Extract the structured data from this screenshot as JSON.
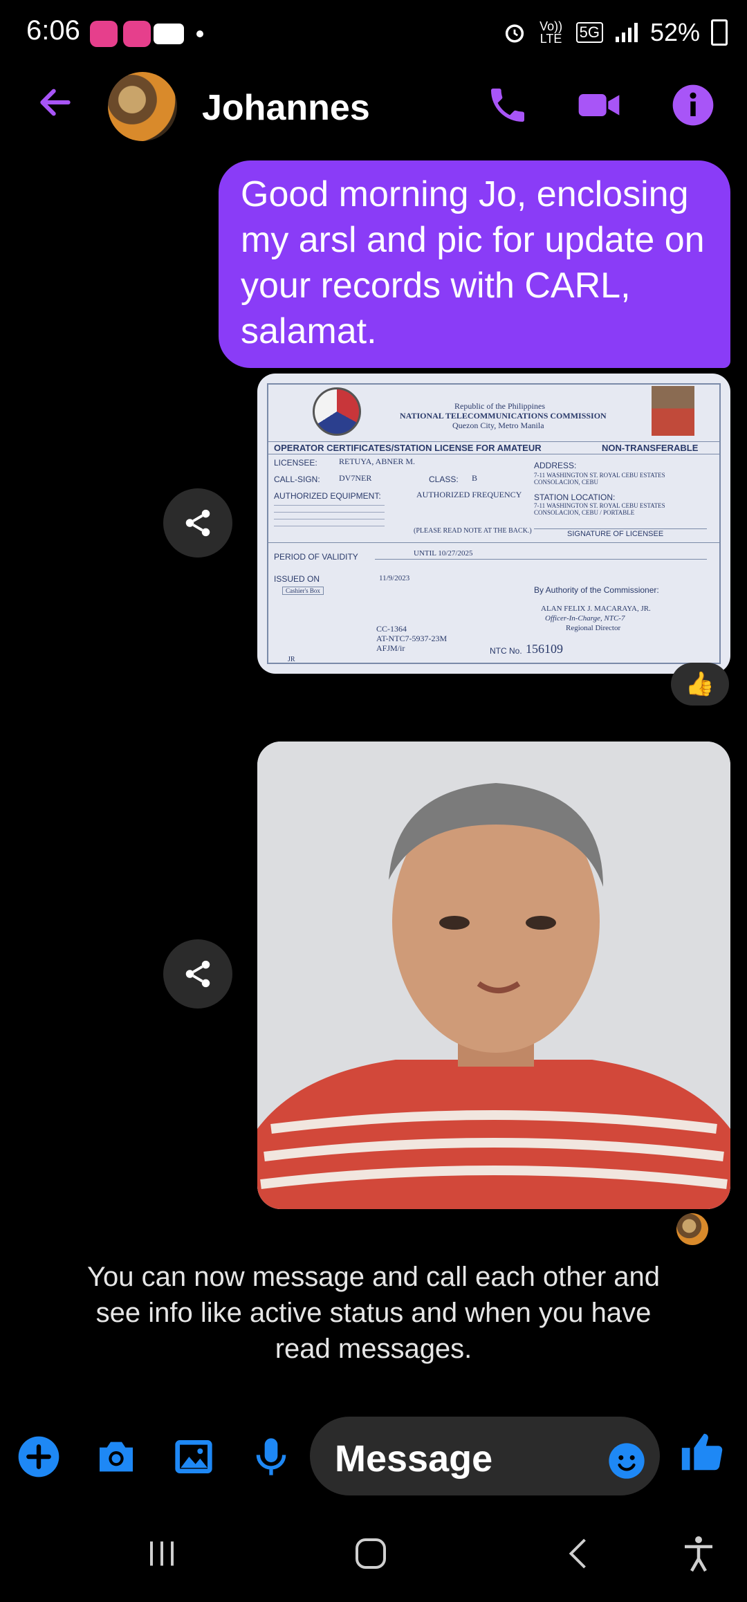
{
  "status_bar": {
    "time": "6:06",
    "app_badge_1": "Laz",
    "app_badge_2": "Laz",
    "network_label": "Vo)) LTE",
    "network_type": "5G",
    "battery": "52%"
  },
  "header": {
    "contact_name": "Johannes"
  },
  "messages": {
    "outgoing_text": "Good morning Jo, enclosing my arsl and pic for update on your records with CARL, salamat.",
    "reaction": "👍",
    "system_notice": "You can now message and call each other and see info like active status and when you have read messages."
  },
  "license_document": {
    "republic": "Republic of the Philippines",
    "agency": "NATIONAL TELECOMMUNICATIONS COMMISSION",
    "city": "Quezon City, Metro Manila",
    "doc_title": "OPERATOR CERTIFICATES/STATION LICENSE FOR AMATEUR",
    "non_transferable": "NON-TRANSFERABLE",
    "licensee_label": "LICENSEE:",
    "licensee": "RETUYA, ABNER M.",
    "callsign_label": "CALL-SIGN:",
    "callsign": "DV7NER",
    "class_label": "CLASS:",
    "class": "B",
    "equipment_label": "AUTHORIZED EQUIPMENT:",
    "frequency_label": "AUTHORIZED FREQUENCY",
    "address_label": "ADDRESS:",
    "address": "7-11 WASHINGTON ST. ROYAL CEBU ESTATES CONSOLACION, CEBU",
    "station_location_label": "STATION LOCATION:",
    "station_location": "7-11 WASHINGTON ST. ROYAL CEBU ESTATES CONSOLACION, CEBU / PORTABLE",
    "signature_label": "SIGNATURE OF LICENSEE",
    "note": "(PLEASE READ NOTE AT THE BACK.)",
    "validity_label": "PERIOD OF VALIDITY",
    "validity": "UNTIL 10/27/2025",
    "issued_label": "ISSUED ON",
    "issued": "11/9/2023",
    "cashier_box": "Cashier's Box",
    "authority": "By Authority of the Commissioner:",
    "signatory": "ALAN FELIX J. MACARAYA, JR.",
    "signatory_role": "Officer-In-Charge, NTC-7",
    "signatory_title": "Regional Director",
    "cc_number": "CC-1364",
    "at_number": "AT-NTC7-5937-23M",
    "initials": "AFJM/ir",
    "ntc_label": "NTC No.",
    "ntc_number": "156109",
    "jr": "JR"
  },
  "composer": {
    "placeholder": "Message"
  },
  "colors": {
    "accent": "#8a3cf7",
    "header_icon": "#a855f7",
    "composer_icon": "#1e88f5",
    "background": "#000000"
  }
}
